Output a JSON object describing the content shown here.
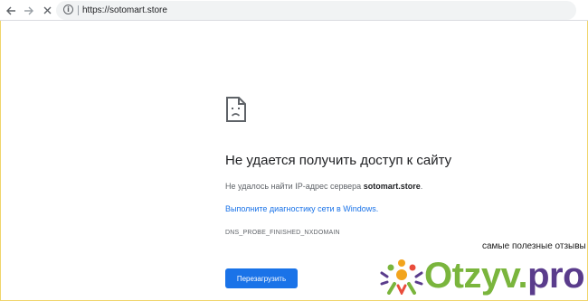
{
  "browser": {
    "url": "https://sotomart.store"
  },
  "error": {
    "title": "Не удается получить доступ к сайту",
    "detail_prefix": "Не удалось найти",
    "detail_ip": "IP",
    "detail_middle": "-адрес сервера",
    "detail_host": "sotomart.store",
    "detail_suffix": ".",
    "diagnostics_link": "Выполните диагностику сети в Windows.",
    "code": "DNS_PROBE_FINISHED_NXDOMAIN",
    "reload_label": "Перезагрузить"
  },
  "watermark": {
    "tagline": "самые полезные отзывы",
    "brand_main": "Otzyv",
    "brand_dot": ".",
    "brand_tld": "pro"
  },
  "icons": {
    "back": "back-arrow-icon",
    "forward": "forward-arrow-icon",
    "stop": "stop-icon",
    "info": "info-icon",
    "error": "sad-page-icon"
  },
  "colors": {
    "accent": "#1a73e8",
    "watermark_green": "#7ab53d",
    "watermark_purple": "#5a3c8c",
    "frame_border": "#f0d56b"
  }
}
